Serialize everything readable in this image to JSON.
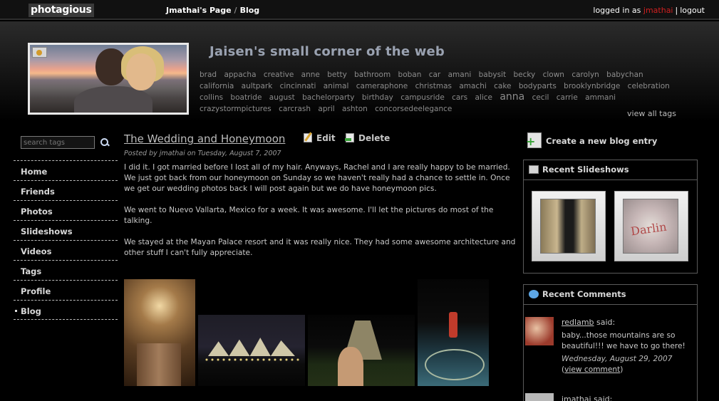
{
  "topbar": {
    "logo": "photagious",
    "breadcrumb_page": "Jmathai's Page",
    "breadcrumb_sep": "/",
    "breadcrumb_blog": "Blog",
    "logged_in_prefix": "logged in as",
    "username": "jmathai",
    "separator": "|",
    "logout": "logout"
  },
  "header": {
    "site_title": "Jaisen's small corner of the web",
    "tags": [
      "brad",
      "appacha",
      "creative",
      "anne",
      "betty",
      "bathroom",
      "boban",
      "car",
      "amani",
      "babysit",
      "becky",
      "clown",
      "carolyn",
      "babychan",
      "california",
      "aultpark",
      "cincinnati",
      "animal",
      "cameraphone",
      "christmas",
      "amachi",
      "cake",
      "bodyparts",
      "brooklynbridge",
      "celebration",
      "collins",
      "boatride",
      "august",
      "bachelorparty",
      "birthday",
      "campusride",
      "cars",
      "alice",
      "anna",
      "cecil",
      "carrie",
      "ammani",
      "crazystormpictures",
      "carcrash",
      "april",
      "ashton",
      "concorsedeelegance"
    ],
    "view_all_tags": "view all tags"
  },
  "sidebar": {
    "search_placeholder": "search tags",
    "nav": [
      {
        "label": "Home"
      },
      {
        "label": "Friends"
      },
      {
        "label": "Photos"
      },
      {
        "label": "Slideshows"
      },
      {
        "label": "Videos"
      },
      {
        "label": "Tags"
      },
      {
        "label": "Profile"
      },
      {
        "label": "Blog"
      }
    ]
  },
  "post": {
    "title": "The Wedding and Honeymoon",
    "edit_label": "Edit",
    "delete_label": "Delete",
    "meta_prefix": "Posted by",
    "meta_author": "jmathai",
    "meta_on": "on",
    "meta_date": "Tuesday, August 7, 2007",
    "paragraphs": [
      "I did it.  I got married before I lost all of my hair.  Anyways, Rachel and I are really happy to be married.  We just got back from our honeymoon on Sunday so we haven't really had a chance to settle in.  Once we get our wedding photos back I will post again but we do have honeymoon pics.",
      "We went to Nuevo Vallarta, Mexico for a week.  It was awesome.  I'll let the pictures do most of the talking.",
      "We stayed at the Mayan Palace resort and it was really nice.  They had some awesome architecture and other stuff I can't fully appreciate."
    ]
  },
  "right": {
    "new_entry": "Create a new blog entry",
    "slideshows_title": "Recent Slideshows",
    "comments_title": "Recent Comments",
    "comment1": {
      "author": "redlamb",
      "said": "said:",
      "text": "baby...those mountains are so beautiful!!! we have to go there!",
      "date": "Wednesday, August 29, 2007",
      "link_open": "(",
      "link_text": "view comment",
      "link_close": ")"
    },
    "comment2": {
      "author": "jmathai",
      "said": "said:"
    }
  },
  "colors": {
    "background": "#000000",
    "username_red": "#d02020",
    "title_blue_gray": "#9aa2b1"
  }
}
